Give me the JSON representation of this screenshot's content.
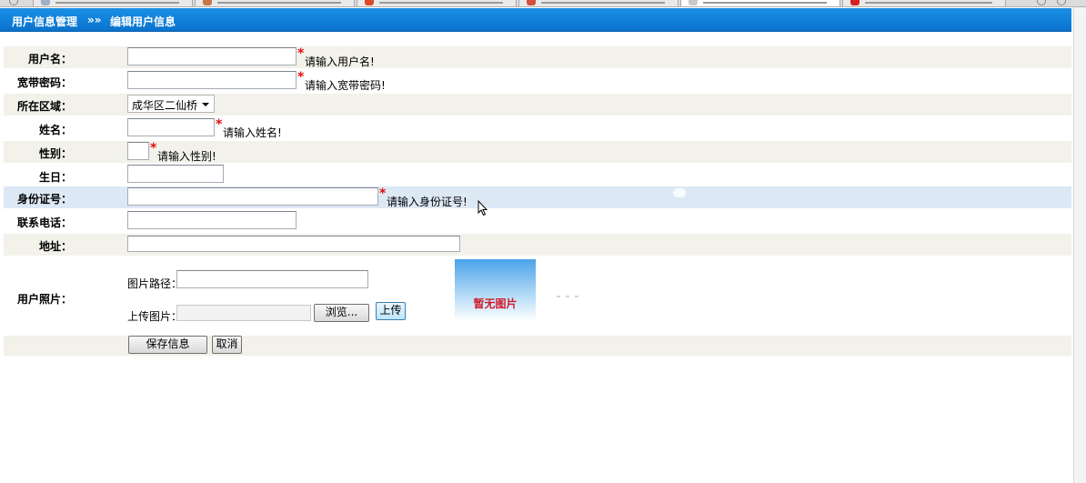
{
  "header": {
    "crumb_parent": "用户信息管理",
    "separator": "»»",
    "crumb_current": "编辑用户信息"
  },
  "form": {
    "username": {
      "label": "用户名：",
      "value": "",
      "hint": "请输入用户名!"
    },
    "password": {
      "label": "宽带密码：",
      "value": "",
      "hint": "请输入宽带密码!"
    },
    "region": {
      "label": "所在区域：",
      "selected": "成华区二仙桥"
    },
    "name": {
      "label": "姓名：",
      "value": "",
      "hint": "请输入姓名!"
    },
    "gender": {
      "label": "性别：",
      "value": "",
      "hint": "请输入性别!"
    },
    "birthday": {
      "label": "生日：",
      "value": ""
    },
    "id_number": {
      "label": "身份证号：",
      "value": "",
      "hint": "请输入身份证号!"
    },
    "phone": {
      "label": "联系电话：",
      "value": ""
    },
    "address": {
      "label": "地址：",
      "value": ""
    },
    "photo": {
      "label": "用户照片：",
      "path_label": "图片路径：",
      "path_value": "",
      "upload_label": "上传图片：",
      "browse_button": "浏览...",
      "upload_button": "上传",
      "placeholder_text": "暂无图片"
    },
    "required_mark": "*"
  },
  "actions": {
    "save_button": "保存信息",
    "cancel_button": "取消"
  },
  "colors": {
    "header_bg": "#0a7fd6",
    "required": "#e01010",
    "no_image_text": "#d01a2a",
    "row_shade": "#f2f1ea",
    "row_hover": "#dde8f5"
  }
}
